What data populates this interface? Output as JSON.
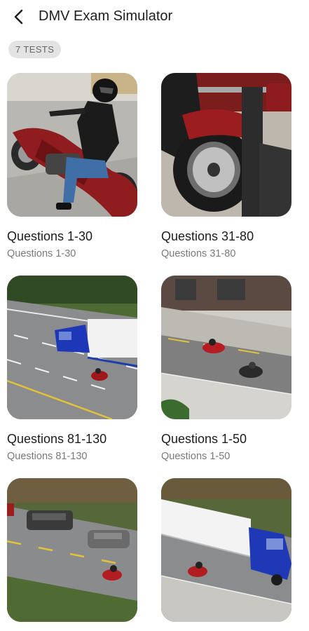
{
  "header": {
    "title": "DMV Exam Simulator",
    "back_icon": "arrow-back-icon"
  },
  "chip": {
    "label": "7 TESTS"
  },
  "tests": [
    {
      "title": "Questions 1-30",
      "subtitle": "Questions 1-30",
      "image": "motorcycle-rider-image"
    },
    {
      "title": "Questions 31-80",
      "subtitle": "Questions 31-80",
      "image": "motorcycle-wheel-image"
    },
    {
      "title": "Questions 81-130",
      "subtitle": "Questions 81-130",
      "image": "highway-truck-image"
    },
    {
      "title": "Questions 1-50",
      "subtitle": "Questions 1-50",
      "image": "city-road-motorcycles-image"
    },
    {
      "title": "",
      "subtitle": "",
      "image": "road-cars-motorcycle-image"
    },
    {
      "title": "",
      "subtitle": "",
      "image": "truck-motorcycle-road-image"
    }
  ],
  "colors": {
    "chip_bg": "#e3e3e3",
    "title": "#1c1c1c",
    "subtitle": "#7a7a7a"
  }
}
